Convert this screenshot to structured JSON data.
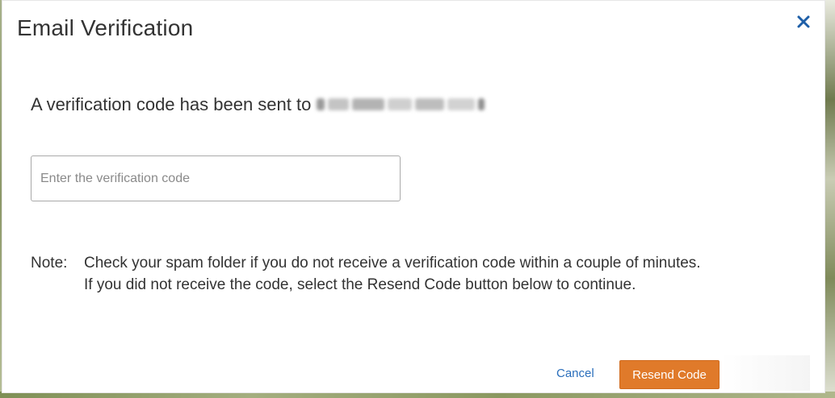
{
  "dialog": {
    "title": "Email Verification",
    "close_icon": "close-icon",
    "message_prefix": "A verification code has been sent to",
    "code_input": {
      "value": "",
      "placeholder": "Enter the verification code"
    },
    "note": {
      "label": "Note:",
      "line1": "Check your spam folder if you do not receive a verification code within a couple of minutes.",
      "line2": "If you did not receive the code, select the Resend Code button below to continue."
    },
    "buttons": {
      "cancel_label": "Cancel",
      "resend_label": "Resend Code"
    }
  },
  "colors": {
    "accent_button": "#e07a2a",
    "link": "#2a6ebb",
    "close_icon": "#1e5fa8",
    "text": "#333333"
  }
}
